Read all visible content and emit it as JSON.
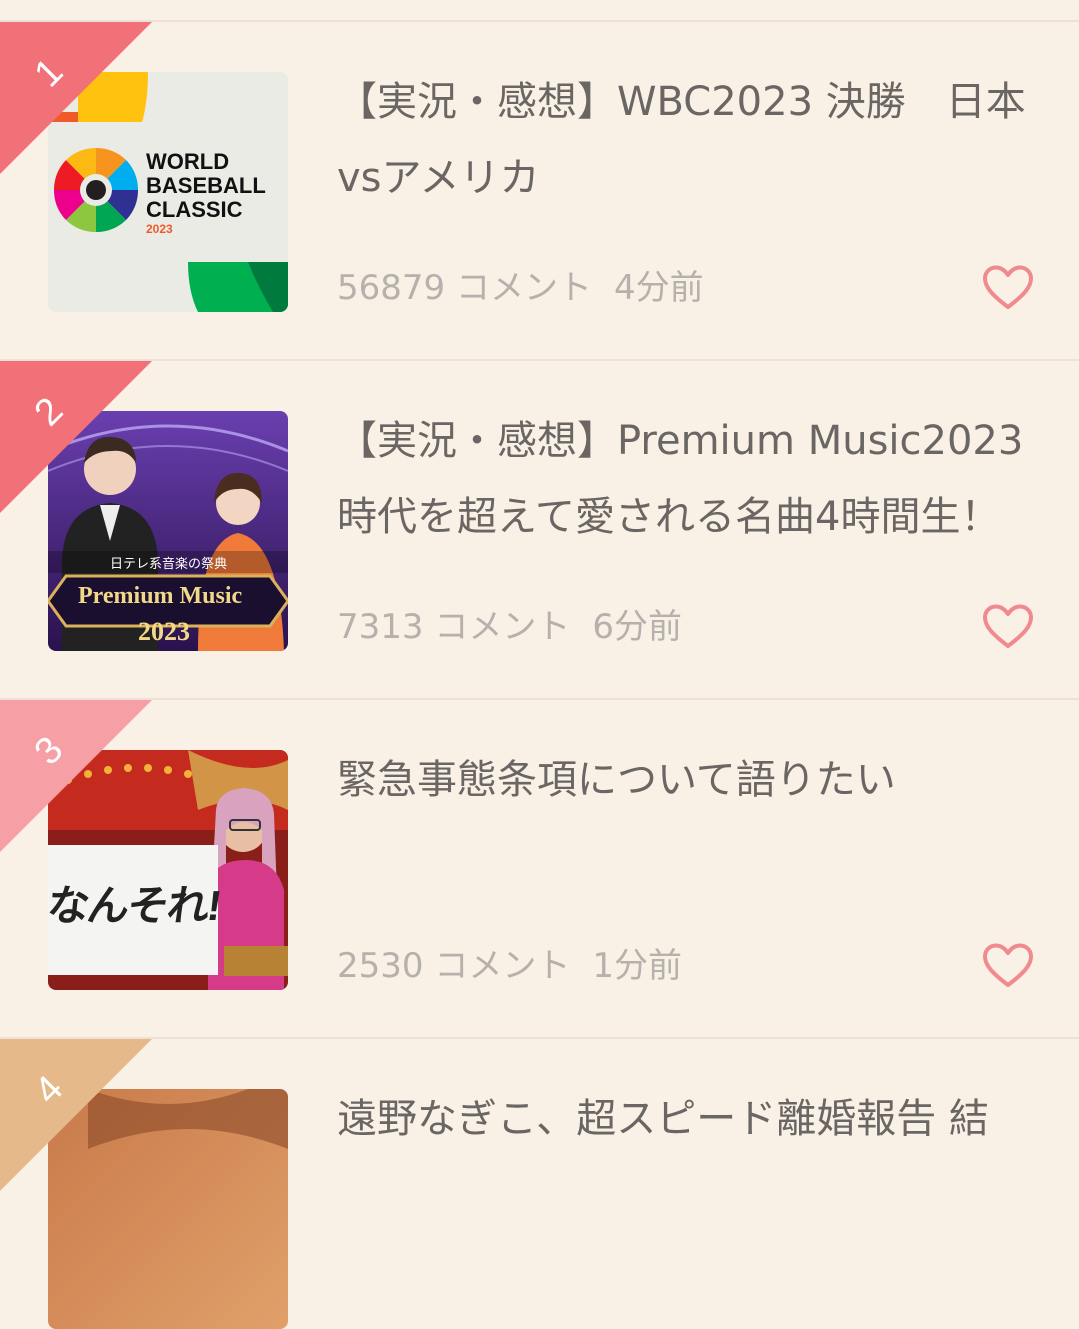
{
  "colors": {
    "background": "#faf1e6",
    "divider": "#ebe1d6",
    "rank_1": "#f27178",
    "rank_2": "#f27178",
    "rank_3": "#f6a0a6",
    "rank_4": "#e5b98a",
    "heart": "#f08a8f",
    "title_text": "#6a6663",
    "meta_text": "#b5b1ad"
  },
  "items": [
    {
      "rank": "1",
      "title": "【実況・感想】WBC2023 決勝　日本vsアメリカ",
      "comments": "56879 コメント",
      "time": "4分前",
      "thumb": {
        "type": "wbc-logo",
        "line1": "WORLD",
        "line2": "BASEBALL",
        "line3": "CLASSIC",
        "year": "2023"
      }
    },
    {
      "rank": "2",
      "title": "【実況・感想】Premium Music2023 時代を超えて愛される名曲4時間生！",
      "comments": "7313 コメント",
      "time": "6分前",
      "thumb": {
        "type": "premium-music",
        "caption": "日テレ系音楽の祭典",
        "logo": "Premium Music",
        "year": "2023"
      }
    },
    {
      "rank": "3",
      "title": "緊急事態条項について語りたい",
      "comments": "2530 コメント",
      "time": "1分前",
      "thumb": {
        "type": "stage-photo",
        "sign": "なんそれ!"
      }
    },
    {
      "rank": "4",
      "title": "遠野なぎこ、超スピード離婚報告 結",
      "comments": "",
      "time": "",
      "thumb": {
        "type": "photo"
      }
    }
  ]
}
